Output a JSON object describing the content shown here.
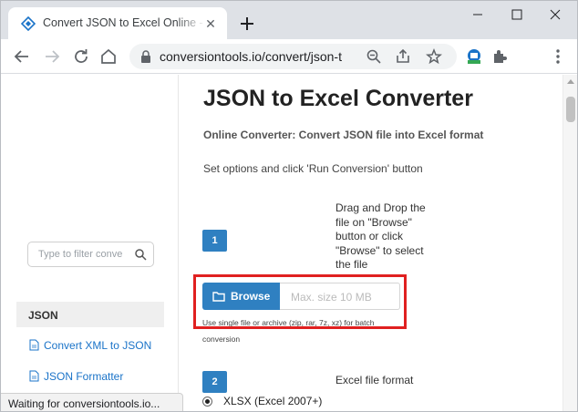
{
  "browser": {
    "tab": {
      "title": "Convert JSON to Excel Online - JS",
      "favicon": "conversiontools-icon"
    },
    "new_tab_symbol": "+",
    "url": "conversiontools.io/convert/json-t..."
  },
  "sidebar": {
    "filter_placeholder": "Type to filter conve",
    "category": "JSON",
    "links": [
      {
        "label": "Convert XML to JSON"
      },
      {
        "label": "JSON Formatter"
      }
    ]
  },
  "main": {
    "title": "JSON to Excel Converter",
    "subtitle": "Online Converter: Convert JSON file into Excel format",
    "instructions": "Set options and click 'Run Conversion' button",
    "step1": {
      "number": "1",
      "drag_text": "Drag and Drop the file on \"Browse\" button or click \"Browse\" to select the file",
      "browse_label": "Browse",
      "size_placeholder": "Max. size 10 MB",
      "hint": "Use single file or archive (zip, rar, 7z, xz) for batch conversion"
    },
    "step2": {
      "number": "2",
      "label": "Excel file format",
      "option": "XLSX (Excel 2007+)"
    }
  },
  "status_bar": "Waiting for conversiontools.io...",
  "colors": {
    "accent": "#2f80c1",
    "highlight": "#e02020",
    "link": "#1a73c8"
  }
}
